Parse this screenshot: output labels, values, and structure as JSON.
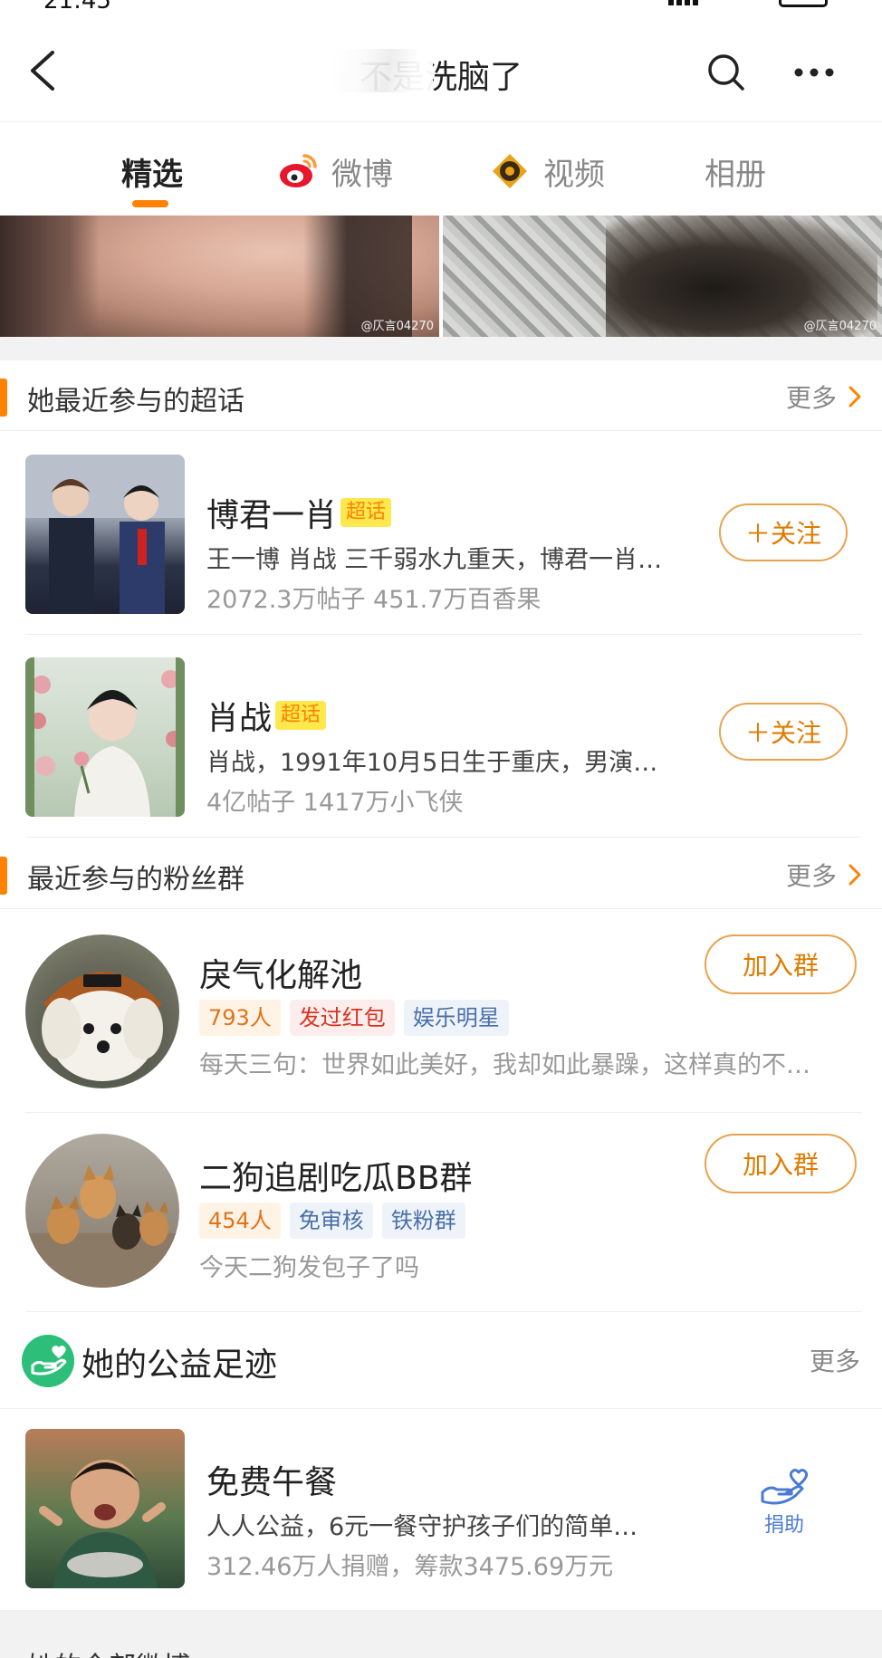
{
  "status_bar": {
    "time": "21:45"
  },
  "nav": {
    "title": "不是洗脑了"
  },
  "tabs": [
    {
      "label": "精选",
      "active": true
    },
    {
      "label": "微博",
      "icon": "weibo-icon"
    },
    {
      "label": "视频",
      "icon": "video-icon"
    },
    {
      "label": "相册"
    }
  ],
  "photos": {
    "watermark": "@仄言04270"
  },
  "super_topics": {
    "title": "她最近参与的超话",
    "more": "更多",
    "badge": "超话",
    "items": [
      {
        "name": "博君一肖",
        "desc": "王一博 肖战  三千弱水九重天，博君一肖…",
        "stats": "2072.3万帖子 451.7万百香果",
        "button": "＋关注"
      },
      {
        "name": "肖战",
        "desc": "肖战，1991年10月5日生于重庆，男演…",
        "stats": "4亿帖子 1417万小飞侠",
        "button": "＋关注"
      }
    ]
  },
  "fan_groups": {
    "title": "最近参与的粉丝群",
    "more": "更多",
    "items": [
      {
        "name": "戾气化解池",
        "tags": [
          "793人",
          "发过红包",
          "娱乐明星"
        ],
        "desc": "每天三句：世界如此美好，我却如此暴躁，这样真的不…",
        "button": "加入群"
      },
      {
        "name": "二狗追剧吃瓜BB群",
        "tags": [
          "454人",
          "免审核",
          "铁粉群"
        ],
        "desc": "今天二狗发包子了吗",
        "button": "加入群"
      }
    ]
  },
  "charity": {
    "title": "她的公益足迹",
    "more": "更多",
    "item": {
      "name": "免费午餐",
      "desc": "人人公益，6元一餐守护孩子们的简单…",
      "stats": "312.46万人捐赠，筹款3475.69万元",
      "button": "捐助"
    }
  },
  "bottom_peek": {
    "label": "她的全部微博"
  },
  "colors": {
    "accent": "#ff8200",
    "charity_green": "#2dbf7a",
    "donate_blue": "#4a7bd0"
  }
}
